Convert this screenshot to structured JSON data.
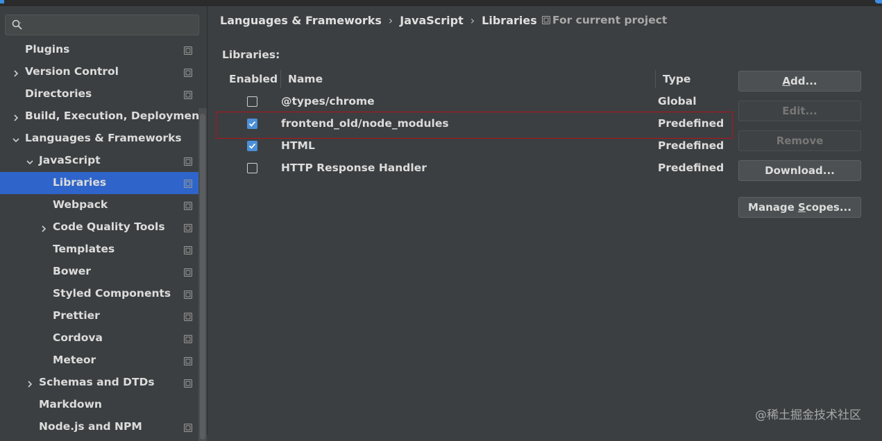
{
  "search": {
    "placeholder": "",
    "value": ""
  },
  "tree": [
    {
      "label": "Plugins",
      "level": 0,
      "arrow": "none",
      "project_icon": true,
      "selected": false
    },
    {
      "label": "Version Control",
      "level": 0,
      "arrow": "right",
      "project_icon": true,
      "selected": false
    },
    {
      "label": "Directories",
      "level": 0,
      "arrow": "none",
      "project_icon": true,
      "selected": false
    },
    {
      "label": "Build, Execution, Deployment",
      "level": 0,
      "arrow": "right",
      "project_icon": false,
      "selected": false
    },
    {
      "label": "Languages & Frameworks",
      "level": 0,
      "arrow": "down",
      "project_icon": false,
      "selected": false
    },
    {
      "label": "JavaScript",
      "level": 1,
      "arrow": "down",
      "project_icon": true,
      "selected": false
    },
    {
      "label": "Libraries",
      "level": 2,
      "arrow": "none",
      "project_icon": true,
      "selected": true
    },
    {
      "label": "Webpack",
      "level": 2,
      "arrow": "none",
      "project_icon": true,
      "selected": false
    },
    {
      "label": "Code Quality Tools",
      "level": 2,
      "arrow": "right",
      "project_icon": true,
      "selected": false
    },
    {
      "label": "Templates",
      "level": 2,
      "arrow": "none",
      "project_icon": true,
      "selected": false
    },
    {
      "label": "Bower",
      "level": 2,
      "arrow": "none",
      "project_icon": true,
      "selected": false
    },
    {
      "label": "Styled Components",
      "level": 2,
      "arrow": "none",
      "project_icon": true,
      "selected": false
    },
    {
      "label": "Prettier",
      "level": 2,
      "arrow": "none",
      "project_icon": true,
      "selected": false
    },
    {
      "label": "Cordova",
      "level": 2,
      "arrow": "none",
      "project_icon": true,
      "selected": false
    },
    {
      "label": "Meteor",
      "level": 2,
      "arrow": "none",
      "project_icon": true,
      "selected": false
    },
    {
      "label": "Schemas and DTDs",
      "level": 1,
      "arrow": "right",
      "project_icon": true,
      "selected": false
    },
    {
      "label": "Markdown",
      "level": 1,
      "arrow": "none",
      "project_icon": false,
      "selected": false
    },
    {
      "label": "Node.js and NPM",
      "level": 1,
      "arrow": "none",
      "project_icon": true,
      "selected": false
    }
  ],
  "breadcrumb": [
    "Languages & Frameworks",
    "JavaScript",
    "Libraries"
  ],
  "scope_label": "For current project",
  "libraries_caption": "Libraries:",
  "table": {
    "headers": {
      "enabled": "Enabled",
      "name": "Name",
      "type": "Type"
    },
    "rows": [
      {
        "enabled": false,
        "name": "@types/chrome",
        "type": "Global",
        "highlighted": false
      },
      {
        "enabled": true,
        "name": "frontend_old/node_modules",
        "type": "Predefined",
        "highlighted": true
      },
      {
        "enabled": true,
        "name": "HTML",
        "type": "Predefined",
        "highlighted": false
      },
      {
        "enabled": false,
        "name": "HTTP Response Handler",
        "type": "Predefined",
        "highlighted": false
      }
    ]
  },
  "buttons": [
    {
      "label": "Add...",
      "mnemonic": "A",
      "enabled": true,
      "name": "add-button"
    },
    {
      "label": "Edit...",
      "mnemonic": "",
      "enabled": false,
      "name": "edit-button"
    },
    {
      "label": "Remove",
      "mnemonic": "",
      "enabled": false,
      "name": "remove-button"
    },
    {
      "label": "Download...",
      "mnemonic": "",
      "enabled": true,
      "name": "download-button"
    },
    {
      "label": "Manage Scopes...",
      "mnemonic": "S",
      "enabled": true,
      "name": "manage-scopes-button"
    }
  ],
  "watermark": "@稀土掘金技术社区",
  "colors": {
    "background": "#3c3f41",
    "selection": "#2f65ca",
    "checkbox_checked": "#4b8fd8",
    "highlight_border": "#b3121c"
  }
}
